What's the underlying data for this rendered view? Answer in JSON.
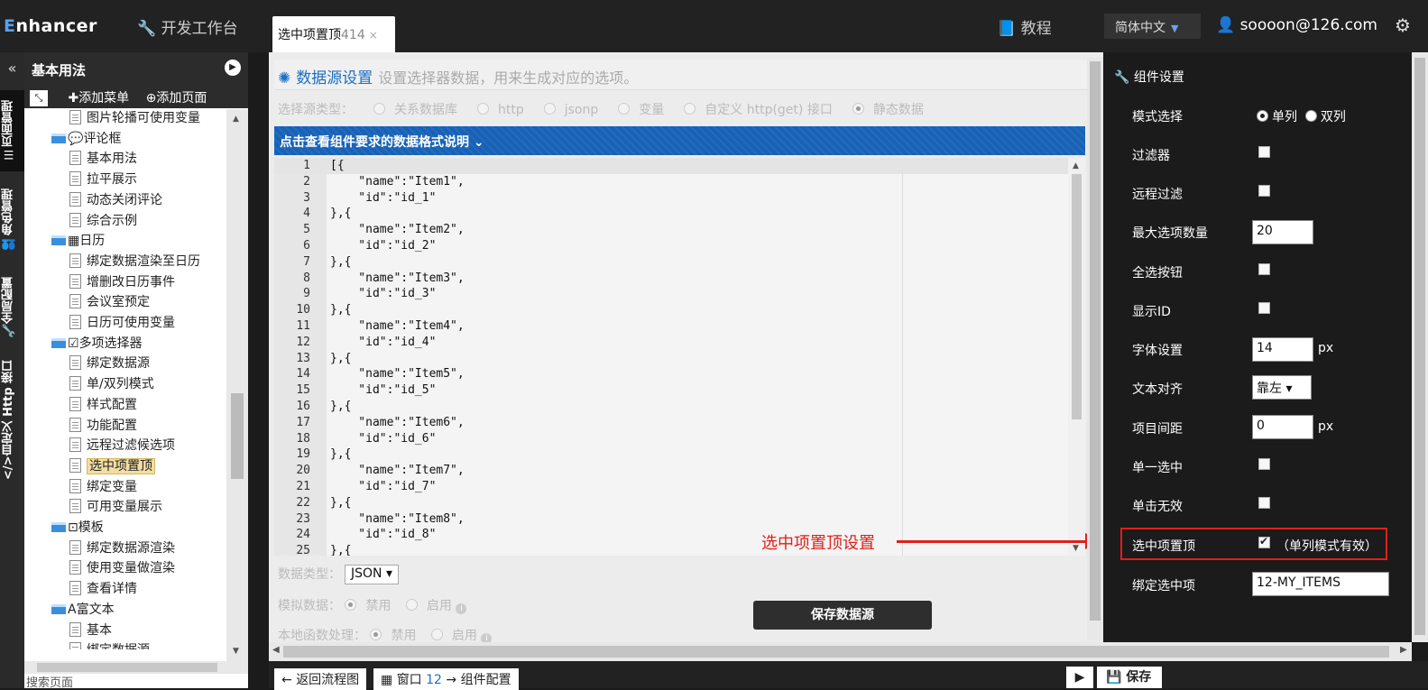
{
  "header": {
    "logo": "nhancer",
    "logo_initial": "E",
    "devbench": "开发工作台",
    "tab_title": "选中项置顶",
    "tab_id": "414",
    "tab_close": "×",
    "tutorial": "教程",
    "language": "简体中文",
    "user": "soooon@126.com"
  },
  "sidebar": {
    "collapse": "«",
    "tabs": [
      "页面管理",
      "角色管理",
      "全局配置",
      "自定义 Http 接口"
    ]
  },
  "tree": {
    "title": "基本用法",
    "add_menu": "添加菜单",
    "add_page": "添加页面",
    "search_placeholder": "搜索页面",
    "nodes": [
      {
        "label": "图片轮播可使用变量",
        "type": "doc"
      },
      {
        "label": "评论框",
        "type": "folder",
        "icon": "💬"
      },
      {
        "label": "基本用法",
        "type": "doc"
      },
      {
        "label": "拉平展示",
        "type": "doc"
      },
      {
        "label": "动态关闭评论",
        "type": "doc"
      },
      {
        "label": "综合示例",
        "type": "doc"
      },
      {
        "label": "日历",
        "type": "folder",
        "icon": "▦"
      },
      {
        "label": "绑定数据渲染至日历",
        "type": "doc"
      },
      {
        "label": "增删改日历事件",
        "type": "doc"
      },
      {
        "label": "会议室预定",
        "type": "doc"
      },
      {
        "label": "日历可使用变量",
        "type": "doc"
      },
      {
        "label": "多项选择器",
        "type": "folder",
        "icon": "☑"
      },
      {
        "label": "绑定数据源",
        "type": "doc"
      },
      {
        "label": "单/双列模式",
        "type": "doc"
      },
      {
        "label": "样式配置",
        "type": "doc"
      },
      {
        "label": "功能配置",
        "type": "doc"
      },
      {
        "label": "远程过滤候选项",
        "type": "doc"
      },
      {
        "label": "选中项置顶",
        "type": "doc",
        "selected": true
      },
      {
        "label": "绑定变量",
        "type": "doc"
      },
      {
        "label": "可用变量展示",
        "type": "doc"
      },
      {
        "label": "模板",
        "type": "folder",
        "icon": "⊡"
      },
      {
        "label": "绑定数据源渲染",
        "type": "doc"
      },
      {
        "label": "使用变量做渲染",
        "type": "doc"
      },
      {
        "label": "查看详情",
        "type": "doc"
      },
      {
        "label": "富文本",
        "type": "folder",
        "icon": "A"
      },
      {
        "label": "基本",
        "type": "doc"
      },
      {
        "label": "绑定数据源",
        "type": "doc"
      }
    ]
  },
  "datasource": {
    "title": "数据源设置",
    "subtitle": "设置选择器数据，用来生成对应的选项。",
    "type_label": "选择源类型：",
    "types": [
      "关系数据库",
      "http",
      "jsonp",
      "变量",
      "自定义 http(get) 接口",
      "静态数据"
    ],
    "selected_type": "静态数据",
    "format_hint": "点击查看组件要求的数据格式说明 ⌄",
    "code_lines": [
      "[{",
      "    \"name\":\"Item1\",",
      "    \"id\":\"id_1\"",
      "},{",
      "    \"name\":\"Item2\",",
      "    \"id\":\"id_2\"",
      "},{",
      "    \"name\":\"Item3\",",
      "    \"id\":\"id_3\"",
      "},{",
      "    \"name\":\"Item4\",",
      "    \"id\":\"id_4\"",
      "},{",
      "    \"name\":\"Item5\",",
      "    \"id\":\"id_5\"",
      "},{",
      "    \"name\":\"Item6\",",
      "    \"id\":\"id_6\"",
      "},{",
      "    \"name\":\"Item7\",",
      "    \"id\":\"id_7\"",
      "},{",
      "    \"name\":\"Item8\",",
      "    \"id\":\"id_8\"",
      "},{"
    ],
    "data_type_label": "数据类型：",
    "data_type_value": "JSON ▾",
    "mock_label": "模拟数据：",
    "local_fn_label": "本地函数处理：",
    "disable": "禁用",
    "enable": "启用",
    "save_button": "保存数据源",
    "annotation": "选中项置顶设置"
  },
  "component": {
    "title": "组件设置",
    "mode_label": "模式选择",
    "mode_single": "单列",
    "mode_double": "双列",
    "mode_selected": "单列",
    "filter": "过滤器",
    "remote_filter": "远程过滤",
    "max_options_label": "最大选项数量",
    "max_options_value": "20",
    "select_all": "全选按钮",
    "show_id": "显示ID",
    "font_label": "字体设置",
    "font_value": "14",
    "px": "px",
    "align_label": "文本对齐",
    "align_value": "靠左 ▾",
    "spacing_label": "项目间距",
    "spacing_value": "0",
    "single_select": "单一选中",
    "click_disable": "单击无效",
    "pin_selected": "选中项置顶",
    "pin_selected_checked": true,
    "pin_note": "（单列模式有效）",
    "bind_label": "绑定选中项",
    "bind_value": "12-MY_ITEMS"
  },
  "footer": {
    "back": "返回流程图",
    "window": "窗口",
    "window_num": "12",
    "window_suffix": "→ 组件配置",
    "save": "保存"
  }
}
